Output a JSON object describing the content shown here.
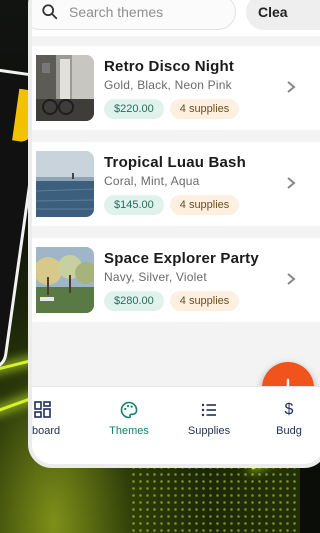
{
  "search": {
    "placeholder": "Search themes",
    "clear_label": "Clea"
  },
  "themes": [
    {
      "title": "Retro Disco Night",
      "colors": "Gold, Black, Neon Pink",
      "price": "$220.00",
      "supplies": "4 supplies",
      "thumb": "street-scene"
    },
    {
      "title": "Tropical Luau Bash",
      "colors": "Coral, Mint, Aqua",
      "price": "$145.00",
      "supplies": "4 supplies",
      "thumb": "sea-scene"
    },
    {
      "title": "Space Explorer Party",
      "colors": "Navy, Silver, Violet",
      "price": "$280.00",
      "supplies": "4 supplies",
      "thumb": "park-scene"
    }
  ],
  "nav": {
    "items": [
      {
        "label": "hboard",
        "icon": "dashboard-icon",
        "active": false
      },
      {
        "label": "Themes",
        "icon": "palette-icon",
        "active": true
      },
      {
        "label": "Supplies",
        "icon": "list-icon",
        "active": false
      },
      {
        "label": "Budg",
        "icon": "dollar-icon",
        "active": false
      }
    ]
  },
  "fab": {
    "icon": "plus-icon"
  },
  "colors": {
    "accent": "#16806a",
    "fab": "#f0531c",
    "price_chip_bg": "#dff2ec",
    "supplies_chip_bg": "#fdf0e0"
  }
}
